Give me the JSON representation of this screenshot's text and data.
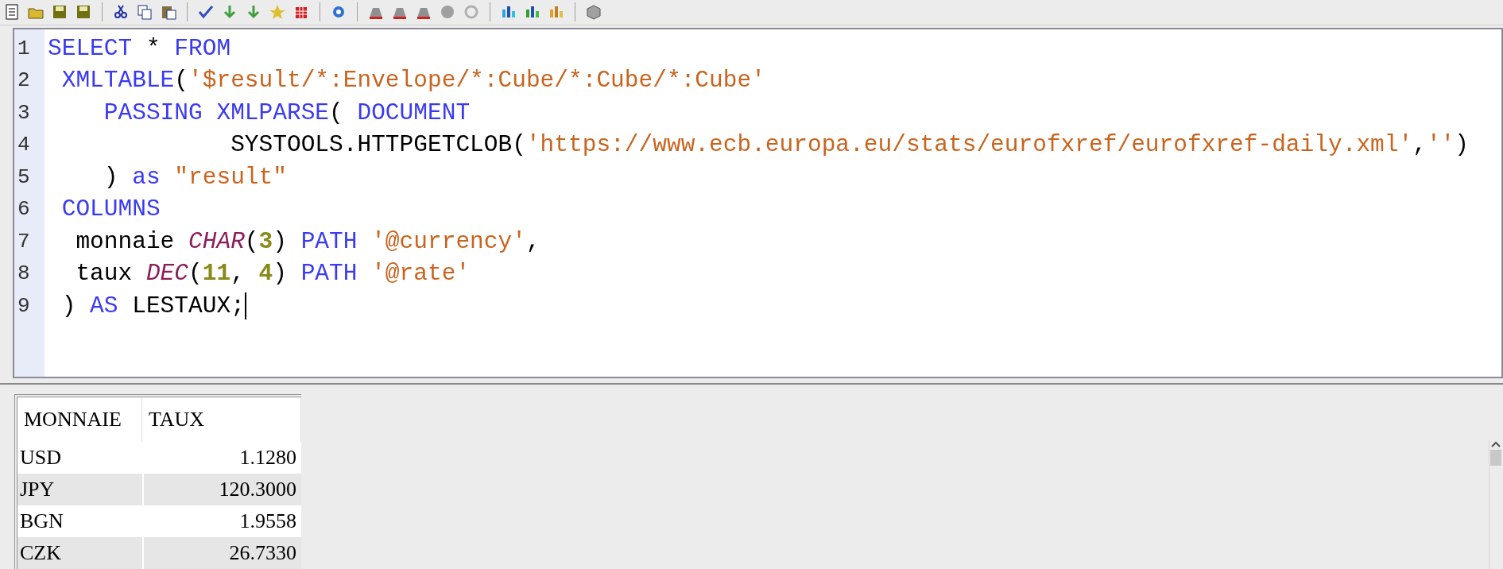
{
  "editor": {
    "lines": [
      {
        "number": "1",
        "tokens": [
          {
            "kind": "keyword",
            "text": "SELECT"
          },
          {
            "kind": "plain",
            "text": " * "
          },
          {
            "kind": "keyword",
            "text": "FROM"
          }
        ]
      },
      {
        "number": "2",
        "tokens": [
          {
            "kind": "keyword",
            "text": " XMLTABLE"
          },
          {
            "kind": "plain",
            "text": "("
          },
          {
            "kind": "string",
            "text": "'$result/*:Envelope/*:Cube/*:Cube/*:Cube'"
          }
        ]
      },
      {
        "number": "3",
        "tokens": [
          {
            "kind": "keyword",
            "text": "    PASSING"
          },
          {
            "kind": "keyword",
            "text": " XMLPARSE"
          },
          {
            "kind": "plain",
            "text": "( "
          },
          {
            "kind": "keyword",
            "text": "DOCUMENT"
          }
        ]
      },
      {
        "number": "4",
        "tokens": [
          {
            "kind": "plain",
            "text": "             SYSTOOLS.HTTPGETCLOB("
          },
          {
            "kind": "string",
            "text": "'https://www.ecb.europa.eu/stats/eurofxref/eurofxref-daily.xml'"
          },
          {
            "kind": "plain",
            "text": ","
          },
          {
            "kind": "string",
            "text": "''"
          },
          {
            "kind": "plain",
            "text": ")"
          }
        ]
      },
      {
        "number": "5",
        "tokens": [
          {
            "kind": "plain",
            "text": "    ) "
          },
          {
            "kind": "keyword",
            "text": "as"
          },
          {
            "kind": "string",
            "text": " \"result\""
          }
        ]
      },
      {
        "number": "6",
        "tokens": [
          {
            "kind": "keyword",
            "text": " COLUMNS"
          }
        ]
      },
      {
        "number": "7",
        "tokens": [
          {
            "kind": "plain",
            "text": "  monnaie "
          },
          {
            "kind": "type",
            "text": "CHAR"
          },
          {
            "kind": "plain",
            "text": "("
          },
          {
            "kind": "number",
            "text": "3"
          },
          {
            "kind": "plain",
            "text": ") "
          },
          {
            "kind": "keyword",
            "text": "PATH"
          },
          {
            "kind": "string",
            "text": " '@currency'"
          },
          {
            "kind": "plain",
            "text": ","
          }
        ]
      },
      {
        "number": "8",
        "tokens": [
          {
            "kind": "plain",
            "text": "  taux "
          },
          {
            "kind": "type",
            "text": "DEC"
          },
          {
            "kind": "plain",
            "text": "("
          },
          {
            "kind": "number",
            "text": "11"
          },
          {
            "kind": "plain",
            "text": ", "
          },
          {
            "kind": "number",
            "text": "4"
          },
          {
            "kind": "plain",
            "text": ") "
          },
          {
            "kind": "keyword",
            "text": "PATH"
          },
          {
            "kind": "string",
            "text": " '@rate'"
          }
        ]
      },
      {
        "number": "9",
        "tokens": [
          {
            "kind": "plain",
            "text": " ) "
          },
          {
            "kind": "keyword",
            "text": "AS"
          },
          {
            "kind": "plain",
            "text": " LESTAUX;"
          }
        ],
        "cursor": true
      }
    ]
  },
  "results": {
    "columns": [
      "MONNAIE",
      "TAUX"
    ],
    "rows": [
      [
        "USD",
        "1.1280"
      ],
      [
        "JPY",
        "120.3000"
      ],
      [
        "BGN",
        "1.9558"
      ],
      [
        "CZK",
        "26.7330"
      ]
    ]
  }
}
